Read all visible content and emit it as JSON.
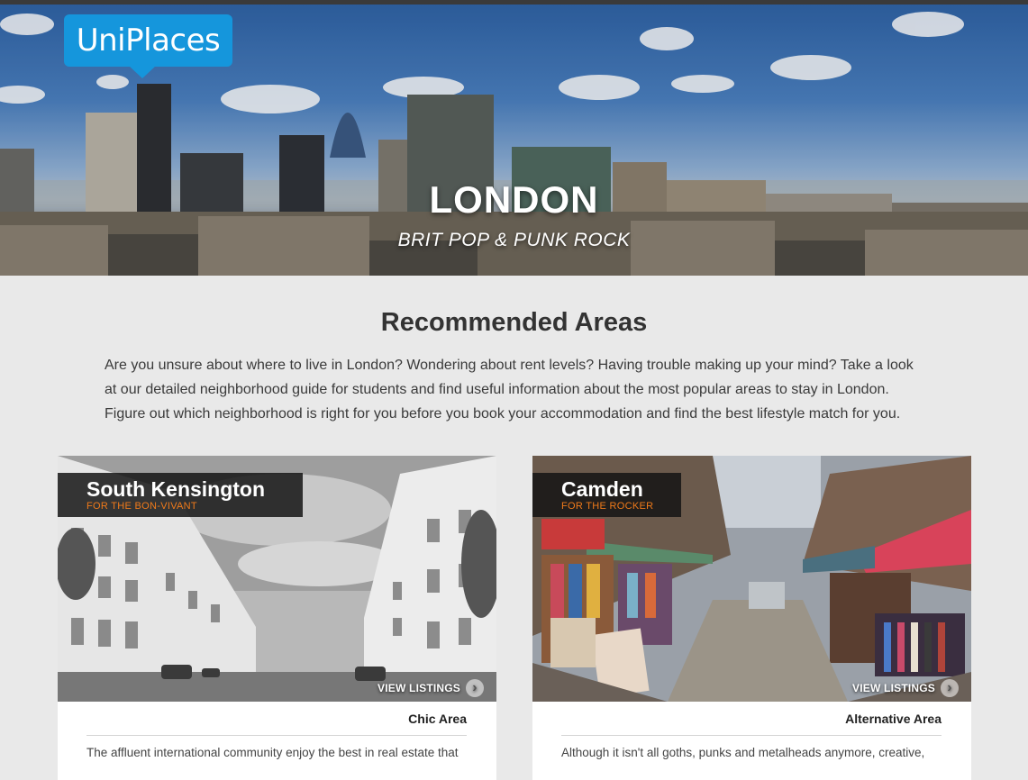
{
  "brand": {
    "logo_text": "UniPlaces"
  },
  "hero": {
    "title": "LONDON",
    "subtitle": "BRIT POP & PUNK ROCK"
  },
  "section": {
    "title": "Recommended Areas",
    "intro": "Are you unsure about where to live in London? Wondering about rent levels? Having trouble making up your mind? Take a look at our detailed neighborhood guide for students and find useful information about the most popular areas to stay in London. Figure out which neighborhood is right for you before you book your accommodation and find the best lifestyle match for you."
  },
  "areas": [
    {
      "name": "South Kensington",
      "tagline": "FOR THE BON-VIVANT",
      "view_listings": "VIEW LISTINGS",
      "category": "Chic Area",
      "description": "The affluent international community enjoy the best in real estate that"
    },
    {
      "name": "Camden",
      "tagline": "FOR THE ROCKER",
      "view_listings": "VIEW LISTINGS",
      "category": "Alternative Area",
      "description": "Although it isn't all goths, punks and metalheads anymore, creative,"
    }
  ],
  "colors": {
    "logo_blue": "#1596dc",
    "tagline_orange": "#f07a1a",
    "page_bg": "#e9e9e9"
  }
}
